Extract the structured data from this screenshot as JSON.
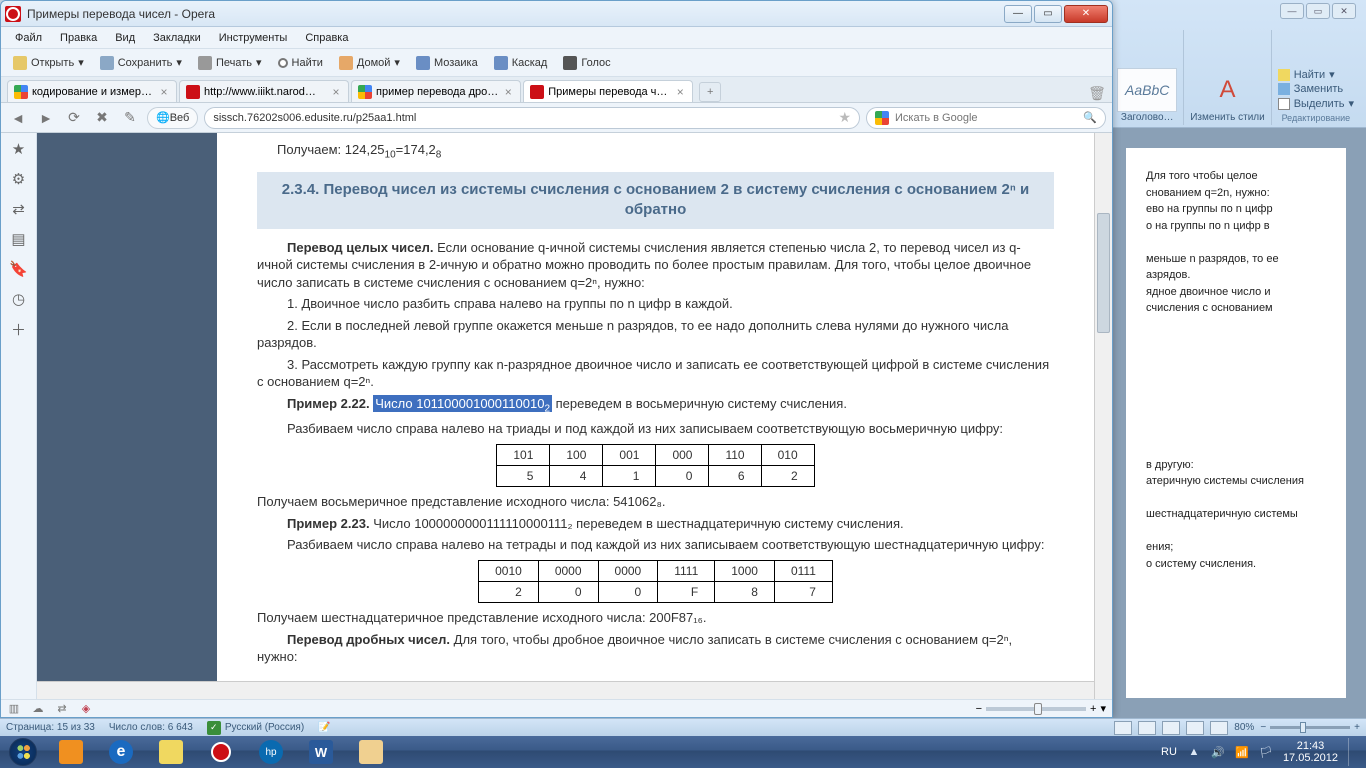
{
  "window": {
    "title": "Примеры перевода чисел - Opera"
  },
  "menu": {
    "file": "Файл",
    "edit": "Правка",
    "view": "Вид",
    "bookmarks": "Закладки",
    "tools": "Инструменты",
    "help": "Справка"
  },
  "toolbar": {
    "open": "Открыть",
    "save": "Сохранить",
    "print": "Печать",
    "find": "Найти",
    "home": "Домой",
    "mosaic": "Мозаика",
    "cascade": "Каскад",
    "voice": "Голос"
  },
  "tabs": [
    {
      "label": "кодирование и измер…"
    },
    {
      "label": "http://www.iiikt.narod…"
    },
    {
      "label": "пример перевода дро…"
    },
    {
      "label": "Примеры перевода ч…"
    }
  ],
  "nav": {
    "scheme": "Веб",
    "url": "sissch.76202s006.edusite.ru/p25aa1.html",
    "search_placeholder": "Искать в Google"
  },
  "page": {
    "line0": "Получаем: 124,25",
    "line0b": "=174,2",
    "heading": "2.3.4. Перевод чисел из системы счисления с основанием 2 в систему счисления с основанием 2ⁿ и обратно",
    "p1a": "Перевод целых чисел.",
    "p1b": "Если основание q-ичной системы счисления является степенью  числа 2, то  перевод  чисел из q-ичной системы счисления в 2-ичную и обратно можно проводить по более простым правилам. Для того, чтобы целое двоичное число записать в системе счисления с основанием q=2ⁿ, нужно:",
    "li1": "1. Двоичное число разбить справа налево на группы по n  цифр в каждой.",
    "li2": "2. Если в последней левой группе окажется меньше n разрядов, то ее надо дополнить слева нулями до нужного числа разрядов.",
    "li3": "3. Рассмотреть каждую группу как n-разрядное двоичное число и  записать ее соответствующей цифрой в системе счисления с основанием q=2ⁿ.",
    "ex222a": "Пример 2.22.",
    "ex222b": "Число 101100001000110010",
    "ex222c": " переведем в восьмеричную систему счисления.",
    "p2": "Разбиваем число справа налево на триады и под каждой из них записываем соответствующую восьмеричную цифру:",
    "table1": {
      "row1": [
        "101",
        "100",
        "001",
        "000",
        "110",
        "010"
      ],
      "row2": [
        "5",
        "4",
        "1",
        "0",
        "6",
        "2"
      ]
    },
    "p3": "Получаем восьмеричное представление исходного числа: 541062₈.",
    "ex223a": "Пример 2.23.",
    "ex223b": "Число 1000000000111110000111₂ переведем в шестнадцатеричную систему счисления.",
    "p4": "Разбиваем число  справа налево на тетрады и под каждой из них записываем соответствующую шестнадцатеричную цифру:",
    "table2": {
      "row1": [
        "0010",
        "0000",
        "0000",
        "1111",
        "1000",
        "0111"
      ],
      "row2": [
        "2",
        "0",
        "0",
        "F",
        "8",
        "7"
      ]
    },
    "p5": "Получаем шестнадцатеричное   представление   исходного   числа: 200F87₁₆.",
    "p6a": "Перевод дробных чисел.",
    "p6b": "Для  того,  чтобы  дробное двоичное число записать в системе счисления с основанием q=2ⁿ, нужно:"
  },
  "ribbon": {
    "style_sample": "AaBbC",
    "style_label": "Заголово…",
    "styles_btn": "Изменить стили",
    "find": "Найти",
    "replace": "Заменить",
    "select": "Выделить",
    "edit_group": "Редактирование"
  },
  "word_hidden": {
    "l1": "Для того чтобы целое",
    "l2": "снованием q=2n, нужно:",
    "l3": "ево на группы по n цифр",
    "l4": "о на группы по n цифр в",
    "l5": "меньше n разрядов, то ее",
    "l6": "азрядов.",
    "l7": "ядное двоичное число и",
    "l8": "счисления с основанием",
    "l9": "в другую:",
    "l10": "атеричную системы счисления",
    "l11": "шестнадцатеричную системы",
    "l12": "ения;",
    "l13": "о систему счисления."
  },
  "word_status": {
    "page": "Страница: 15 из 33",
    "words": "Число слов: 6 643",
    "lang": "Русский (Россия)",
    "zoom": "80%"
  },
  "tray": {
    "lang": "RU",
    "time": "21:43",
    "date": "17.05.2012"
  }
}
